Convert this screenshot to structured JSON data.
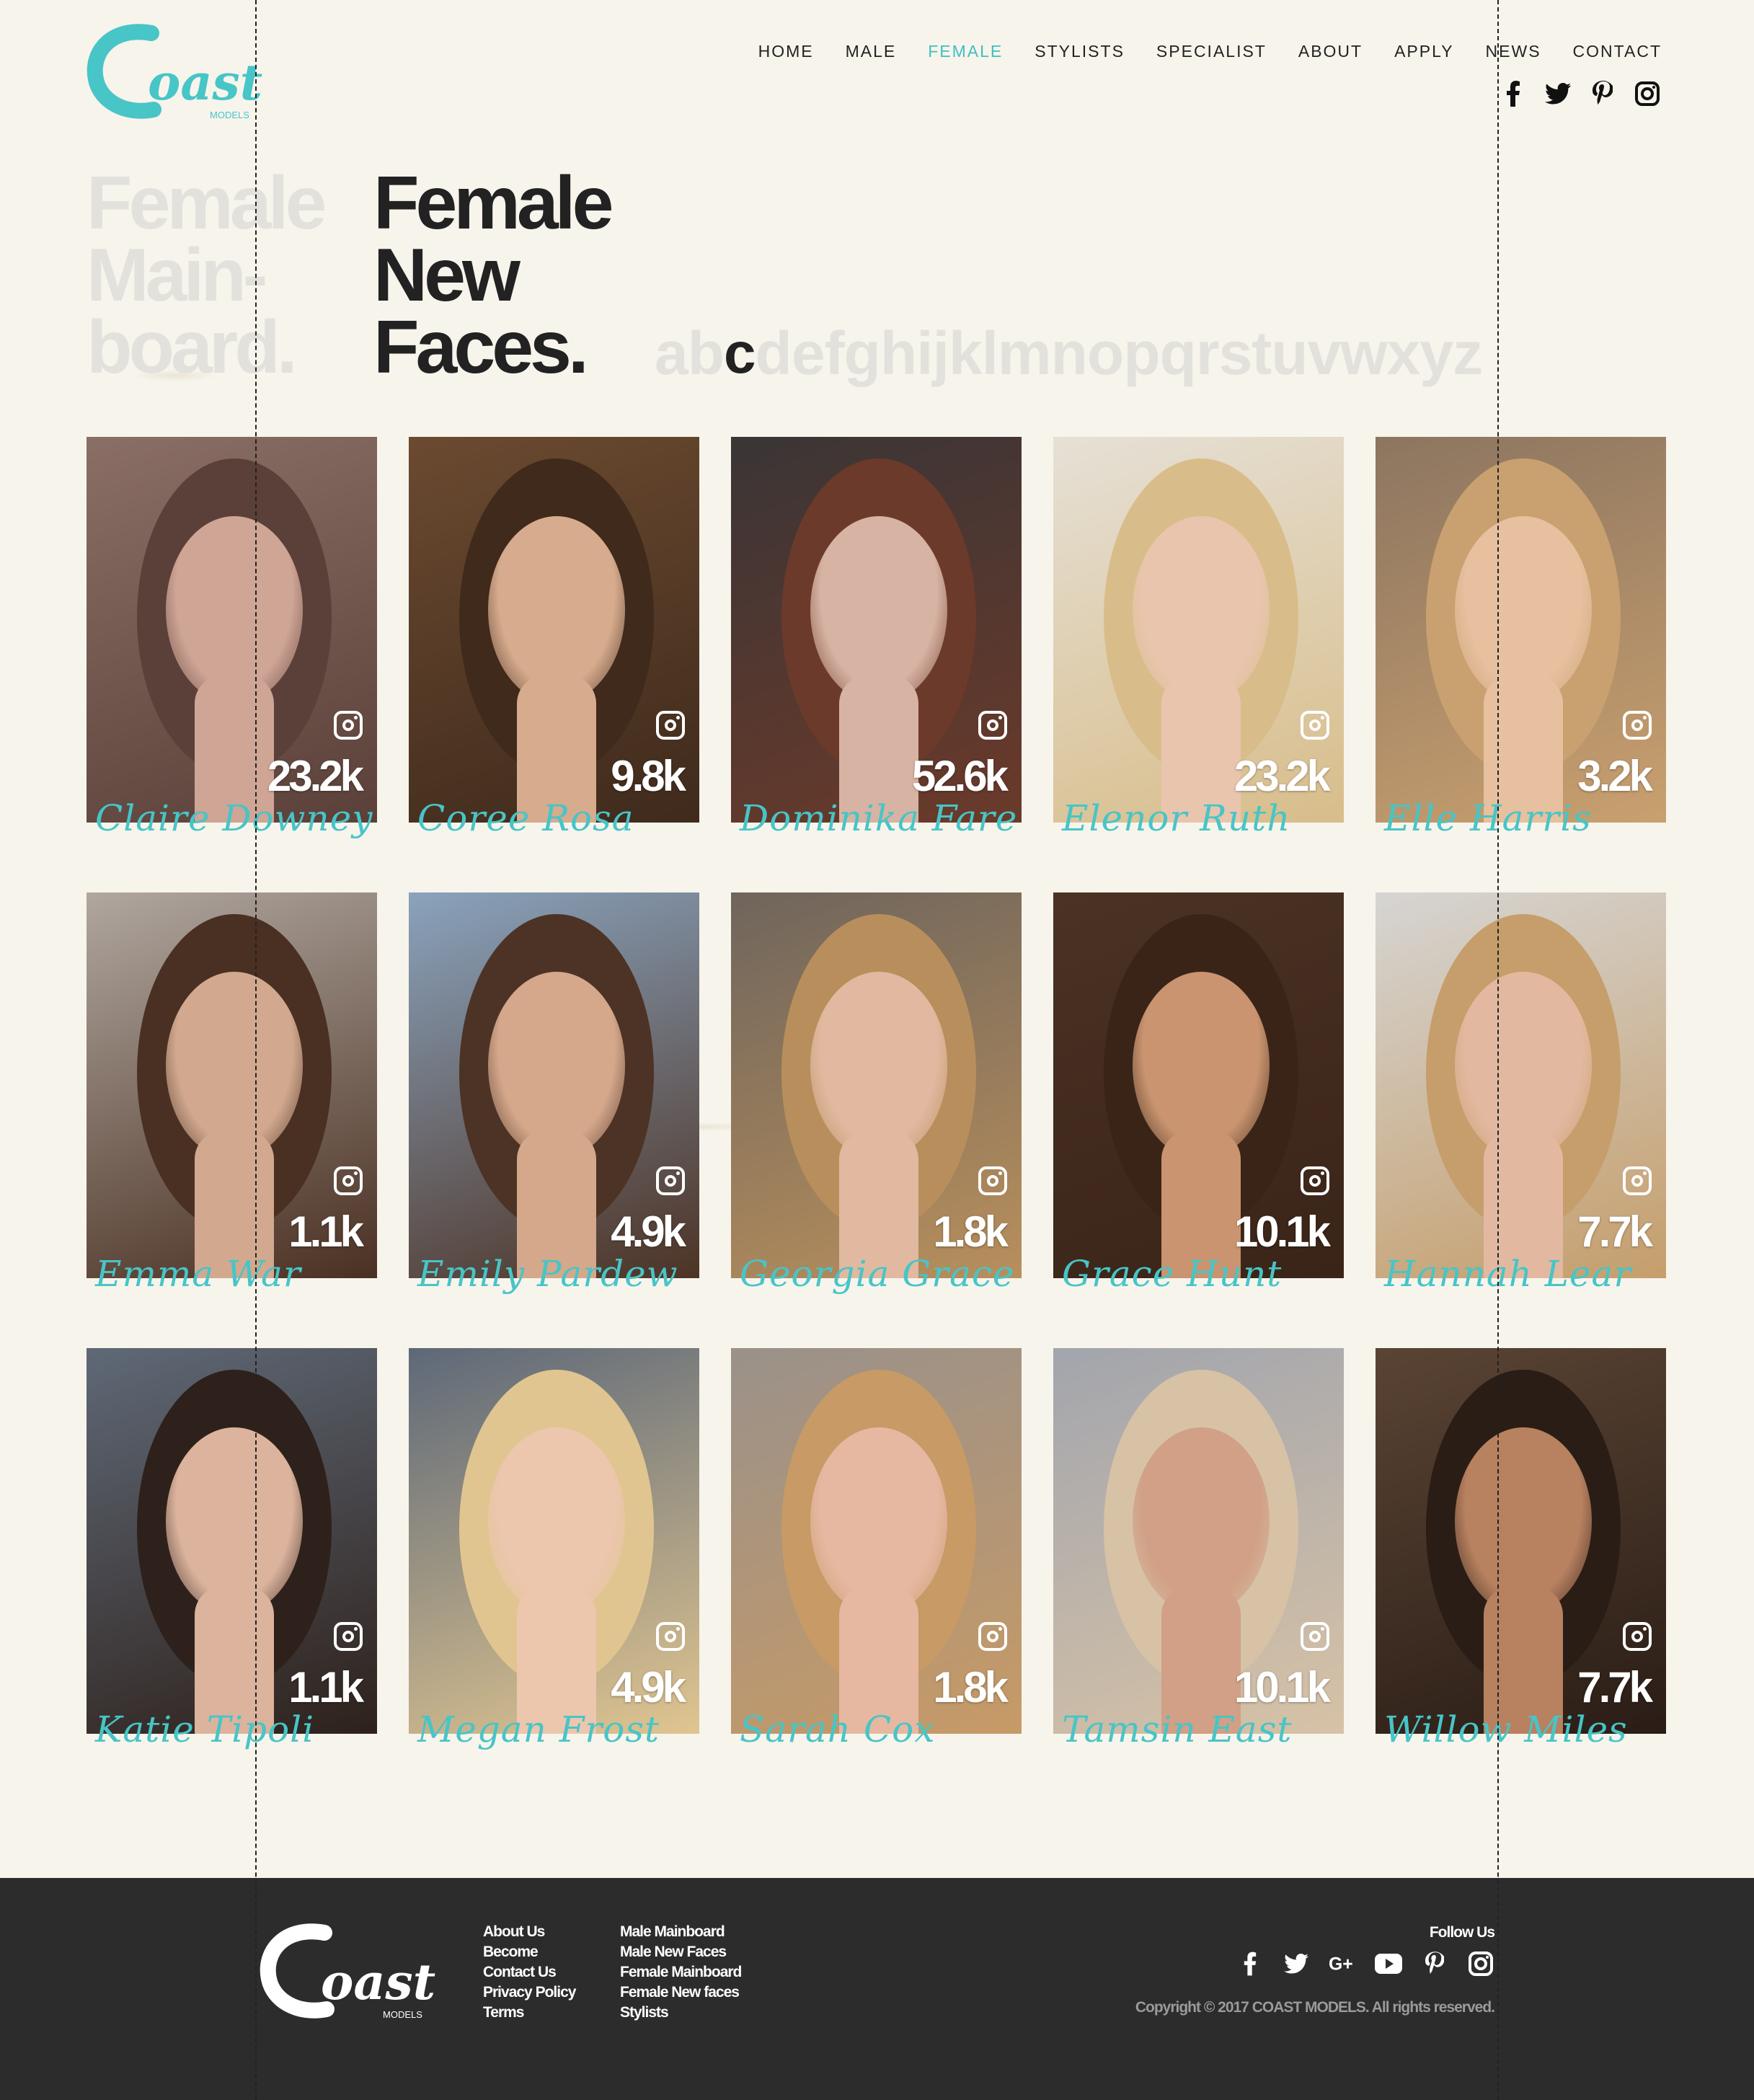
{
  "brand": {
    "name": "Coast",
    "sub": "MODELS",
    "accent": "#47c5c7"
  },
  "nav": [
    {
      "label": "HOME",
      "active": false
    },
    {
      "label": "MALE",
      "active": false
    },
    {
      "label": "FEMALE",
      "active": true
    },
    {
      "label": "STYLISTS",
      "active": false
    },
    {
      "label": "SPECIALIST",
      "active": false
    },
    {
      "label": "ABOUT",
      "active": false
    },
    {
      "label": "APPLY",
      "active": false
    },
    {
      "label": "NEWS",
      "active": false
    },
    {
      "label": "CONTACT",
      "active": false
    }
  ],
  "social_icons": [
    "facebook-icon",
    "twitter-icon",
    "pinterest-icon",
    "instagram-icon"
  ],
  "page": {
    "ghost_title": [
      "Female",
      "Main-",
      "board."
    ],
    "title": [
      "Female",
      "New",
      "Faces."
    ]
  },
  "alphabet": {
    "letters": [
      "a",
      "b",
      "c",
      "d",
      "e",
      "f",
      "g",
      "h",
      "i",
      "j",
      "k",
      "l",
      "m",
      "n",
      "o",
      "p",
      "q",
      "r",
      "s",
      "t",
      "u",
      "v",
      "w",
      "x",
      "y",
      "z"
    ],
    "current": "c"
  },
  "models": [
    {
      "name": "Claire Downey",
      "followers": "23.2k",
      "tone": [
        "#8a6f66",
        "#cfa596",
        "#5a4038"
      ]
    },
    {
      "name": "Coree Rosa",
      "followers": "9.8k",
      "tone": [
        "#6b4a30",
        "#d7ab8d",
        "#3f2a1c"
      ]
    },
    {
      "name": "Dominika Fare",
      "followers": "52.6k",
      "tone": [
        "#3a3536",
        "#d7b3a3",
        "#6b3a2a"
      ]
    },
    {
      "name": "Elenor Ruth",
      "followers": "23.2k",
      "tone": [
        "#e6e0d6",
        "#e9c5ae",
        "#d8bd8a"
      ]
    },
    {
      "name": "Elle Harris",
      "followers": "3.2k",
      "tone": [
        "#8c7560",
        "#e6c09f",
        "#c9a06f"
      ]
    },
    {
      "name": "Emma War",
      "followers": "1.1k",
      "tone": [
        "#b0a79f",
        "#d2a98f",
        "#4a3022"
      ]
    },
    {
      "name": "Emily Pardew",
      "followers": "4.9k",
      "tone": [
        "#8aa3bd",
        "#d5a88b",
        "#4d3325"
      ]
    },
    {
      "name": "Georgia Grace",
      "followers": "1.8k",
      "tone": [
        "#6f655c",
        "#e0b9a0",
        "#b88f5c"
      ]
    },
    {
      "name": "Grace Hunt",
      "followers": "10.1k",
      "tone": [
        "#4a3224",
        "#c9946f",
        "#3a2418"
      ]
    },
    {
      "name": "Hannah Lear",
      "followers": "7.7k",
      "tone": [
        "#d6d5d3",
        "#e2b9a0",
        "#c59e6b"
      ]
    },
    {
      "name": "Katie Tipoli",
      "followers": "1.1k",
      "tone": [
        "#5f6977",
        "#dcb39d",
        "#2e211b"
      ]
    },
    {
      "name": "Megan Frost",
      "followers": "4.9k",
      "tone": [
        "#5d6878",
        "#ecc6ad",
        "#e0c590"
      ]
    },
    {
      "name": "Sarah Cox",
      "followers": "1.8k",
      "tone": [
        "#9a918a",
        "#e6b8a2",
        "#c79a66"
      ]
    },
    {
      "name": "Tamsin East",
      "followers": "10.1k",
      "tone": [
        "#a2a5ad",
        "#d1a086",
        "#d7c2a6"
      ]
    },
    {
      "name": "Willow Miles",
      "followers": "7.7k",
      "tone": [
        "#5a4434",
        "#b88160",
        "#2a1d16"
      ]
    }
  ],
  "footer": {
    "col1": [
      "About Us",
      "Become",
      "Contact Us",
      "Privacy Policy",
      "Terms"
    ],
    "col2": [
      "Male Mainboard",
      "Male New Faces",
      "Female Mainboard",
      "Female New faces",
      "Stylists"
    ],
    "follow_label": "Follow Us",
    "social_icons": [
      "facebook-icon",
      "twitter-icon",
      "google-plus-icon",
      "youtube-icon",
      "pinterest-icon",
      "instagram-icon"
    ],
    "copyright": "Copyright © 2017 COAST MODELS. All rights reserved."
  }
}
